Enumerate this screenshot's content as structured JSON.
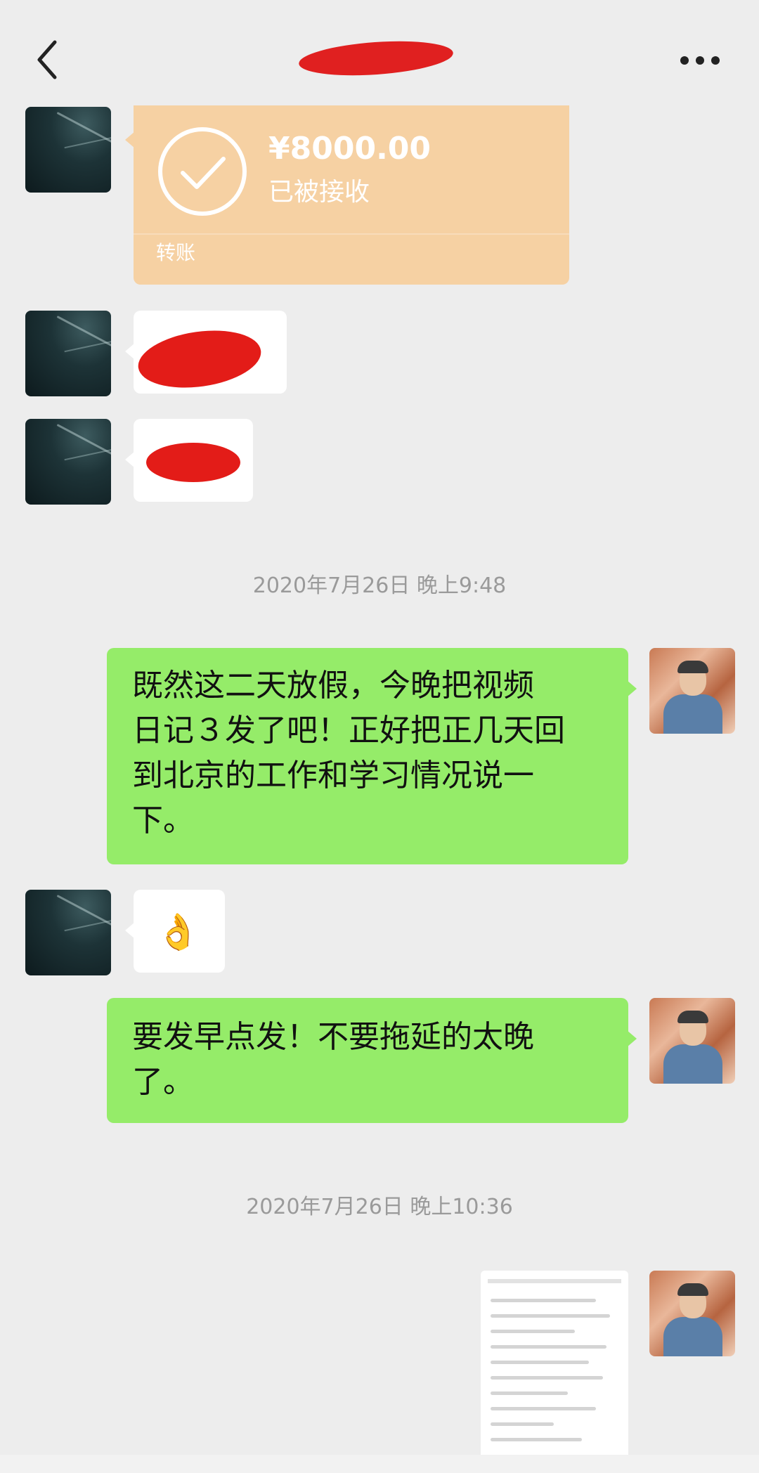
{
  "header": {
    "title": "",
    "back_icon": "chevron-left-icon",
    "more_icon": "more-horizontal-icon"
  },
  "transfer": {
    "amount": "¥8000.00",
    "status": "已被接收",
    "label": "转账",
    "icon": "check-circle-icon",
    "color": "#f6d1a3"
  },
  "timestamps": {
    "first": "2020年7月26日 晚上9:48",
    "second": "2020年7月26日 晚上10:36"
  },
  "messages": {
    "m1": "既然这二天放假，今晚把视频日记3发了吧！正好把正几天回到北京的工作和学习情况说一下。",
    "m1_lines": [
      "既然这二天放假，今晚把视频",
      "日记３发了吧！正好把正几天回",
      "到北京的工作和学习情况说一",
      "下。"
    ],
    "ok_emoji": "👌",
    "m2_lines": [
      "要发早点发！不要拖延的太晚",
      "了。"
    ]
  },
  "colors": {
    "background": "#ededed",
    "sent_bubble": "#95ec69",
    "received_bubble": "#ffffff",
    "redaction": "#e31c18"
  }
}
